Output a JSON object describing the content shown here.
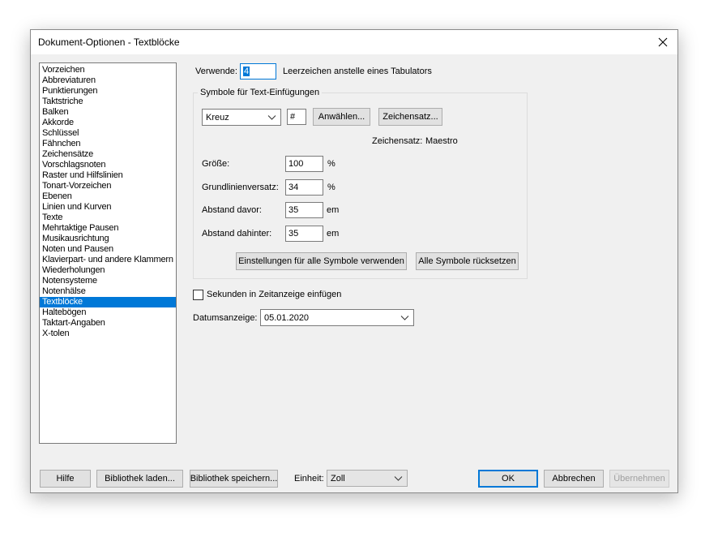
{
  "dialog": {
    "title": "Dokument-Optionen - Textblöcke",
    "close_icon": "close-x-icon"
  },
  "sidebar": {
    "selected_index": 22,
    "items": [
      "Vorzeichen",
      "Abbreviaturen",
      "Punktierungen",
      "Taktstriche",
      "Balken",
      "Akkorde",
      "Schlüssel",
      "Fähnchen",
      "Zeichensätze",
      "Vorschlagsnoten",
      "Raster und Hilfslinien",
      "Tonart-Vorzeichen",
      "Ebenen",
      "Linien und Kurven",
      "Texte",
      "Mehrtaktige Pausen",
      "Musikausrichtung",
      "Noten und Pausen",
      "Klavierpart- und andere Klammern",
      "Wiederholungen",
      "Notensysteme",
      "Notenhälse",
      "Textblöcke",
      "Haltebögen",
      "Taktart-Angaben",
      "X-tolen"
    ]
  },
  "main": {
    "verwende_label": "Verwende:",
    "verwende_value": "4",
    "verwende_suffix": "Leerzeichen anstelle eines Tabulators",
    "group_title": "Symbole für Text-Einfügungen",
    "symbol_select": "Kreuz",
    "symbol_char": "#",
    "select_button": "Anwählen...",
    "charset_button": "Zeichensatz...",
    "charset_label": "Zeichensatz:",
    "charset_value": "Maestro",
    "size_label": "Größe:",
    "size_value": "100",
    "size_unit": "%",
    "baseline_label": "Grundlinienversatz:",
    "baseline_value": "34",
    "baseline_unit": "%",
    "space_before_label": "Abstand davor:",
    "space_before_value": "35",
    "space_before_unit": "em",
    "space_after_label": "Abstand dahinter:",
    "space_after_value": "35",
    "space_after_unit": "em",
    "apply_all_button": "Einstellungen für alle Symbole verwenden",
    "reset_all_button": "Alle Symbole rücksetzen",
    "seconds_checkbox_label": "Sekunden in Zeitanzeige einfügen",
    "seconds_checked": false,
    "date_label": "Datumsanzeige:",
    "date_value": "05.01.2020"
  },
  "footer": {
    "help_button": "Hilfe",
    "load_library_button": "Bibliothek laden...",
    "save_library_button": "Bibliothek speichern...",
    "unit_label": "Einheit:",
    "unit_value": "Zoll",
    "ok_button": "OK",
    "cancel_button": "Abbrechen",
    "apply_button": "Übernehmen"
  },
  "colors": {
    "accent": "#0078d7",
    "dialog_bg": "#f0f0f0",
    "button_bg": "#e1e1e1"
  }
}
